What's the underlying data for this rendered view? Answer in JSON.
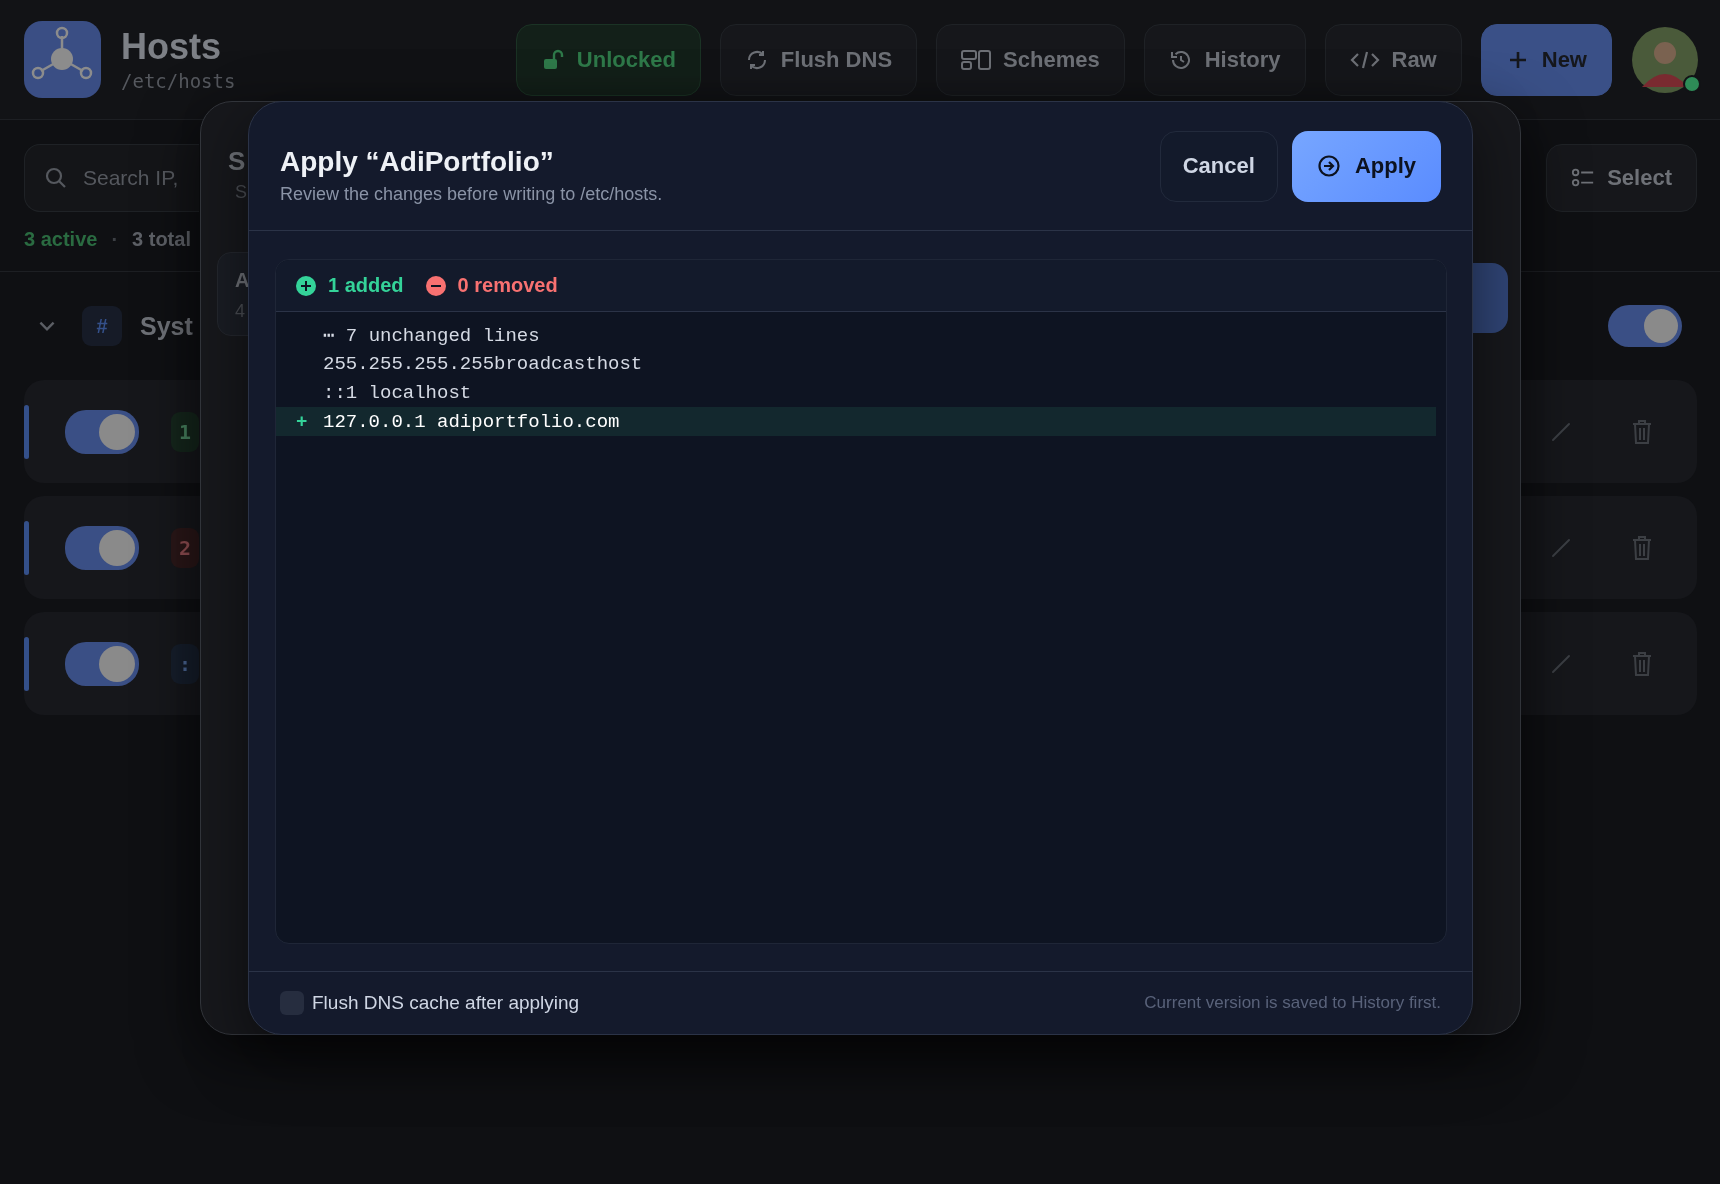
{
  "app": {
    "title": "Hosts",
    "path": "/etc/hosts"
  },
  "toolbar": [
    {
      "kind": "lock",
      "label": "Unlocked"
    },
    {
      "kind": "flush",
      "label": "Flush DNS"
    },
    {
      "kind": "schemes",
      "label": "Schemes"
    },
    {
      "kind": "history",
      "label": "History"
    },
    {
      "kind": "raw",
      "label": "Raw"
    },
    {
      "kind": "new",
      "label": "New"
    }
  ],
  "avatar": {
    "online": true
  },
  "search": {
    "placeholder": "Search IP,"
  },
  "summary": {
    "active": "3 active",
    "separator": "·",
    "total": "3 total"
  },
  "select_button": "Select",
  "section": {
    "badge": "#",
    "title": "Syst",
    "expanded": true,
    "on": true
  },
  "rows": [
    {
      "on": true,
      "badge": "1",
      "color": "#15261c"
    },
    {
      "on": true,
      "badge": "2",
      "color": "#2a1718"
    },
    {
      "on": true,
      "badge": ":",
      "color": "#161e2b"
    }
  ],
  "backdrop_dialog": {
    "title": "S",
    "subtitle": "S",
    "card_title": "A",
    "card_subtitle": "4"
  },
  "dialog": {
    "title": "Apply “AdiPortfolio”",
    "subtitle": "Review the changes before writing to /etc/hosts.",
    "cancel": "Cancel",
    "apply": "Apply",
    "added": "1 added",
    "removed": "0 removed",
    "lines": [
      {
        "kind": "collapsed",
        "text": "⋯ 7 unchanged lines"
      },
      {
        "kind": "context",
        "text": "255.255.255.255broadcasthost"
      },
      {
        "kind": "context",
        "text": "::1 localhost"
      },
      {
        "kind": "added",
        "marker": "+",
        "text": "127.0.0.1 adiportfolio.com"
      }
    ],
    "flush_dns": {
      "label": "Flush DNS cache after applying",
      "checked": false
    },
    "note": "Current version is saved to History first."
  }
}
